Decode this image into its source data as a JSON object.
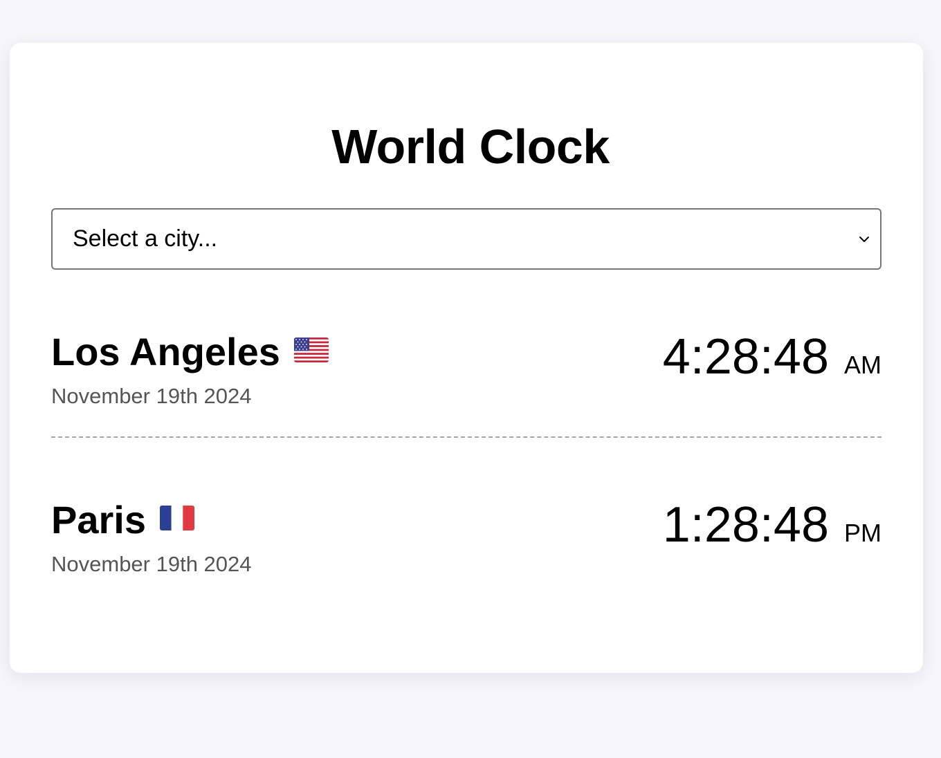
{
  "app": {
    "title": "World Clock"
  },
  "city_select": {
    "placeholder": "Select a city...",
    "icon": "chevron-down-icon"
  },
  "cities": [
    {
      "name": "Los Angeles",
      "flag": "🇺🇸",
      "flag_icon": "us-flag-icon",
      "date": "November 19th 2024",
      "time": "4:28:48",
      "period": "AM"
    },
    {
      "name": "Paris",
      "flag": "🇫🇷",
      "flag_icon": "france-flag-icon",
      "date": "November 19th 2024",
      "time": "1:28:48",
      "period": "PM"
    }
  ],
  "colors": {
    "page_background": "#f6f6fb",
    "card_background": "#ffffff",
    "date_text": "#555555",
    "divider": "#a5a5a5"
  }
}
